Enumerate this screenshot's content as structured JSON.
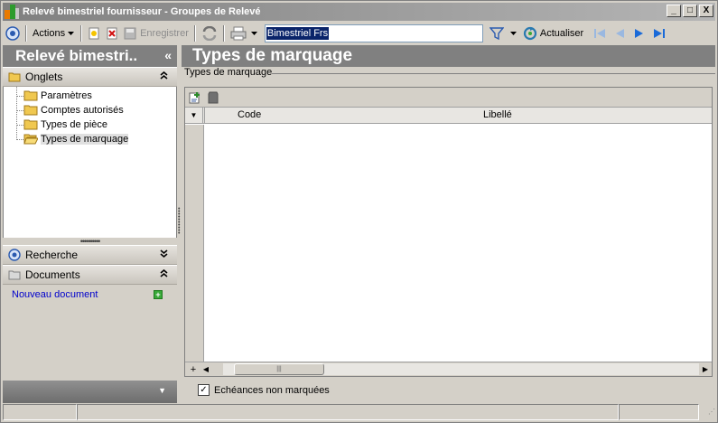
{
  "window": {
    "title": "Relevé bimestriel fournisseur -  Groupes de Relevé",
    "controls": [
      "_",
      "□",
      "X"
    ]
  },
  "toolbar": {
    "actions_label": "Actions",
    "save_label": "Enregistrer",
    "combo_value": "Bimestriel Frs",
    "refresh_label": "Actualiser"
  },
  "left": {
    "header": "Relevé bimestri..",
    "header_chevron": "«",
    "onglets": {
      "label": "Onglets",
      "items": [
        {
          "label": "Paramètres"
        },
        {
          "label": "Comptes autorisés"
        },
        {
          "label": "Types de pièce"
        },
        {
          "label": "Types de marquage"
        }
      ],
      "selected": "Types de marquage"
    },
    "recherche": {
      "label": "Recherche"
    },
    "documents": {
      "label": "Documents",
      "new_document": "Nouveau document"
    }
  },
  "right": {
    "header": "Types de marquage",
    "groupbox": "Types de marquage",
    "grid": {
      "columns": [
        "Code",
        "Libellé"
      ],
      "rows": []
    },
    "checkbox": {
      "label": "Echéances non marquées",
      "checked": true
    }
  }
}
